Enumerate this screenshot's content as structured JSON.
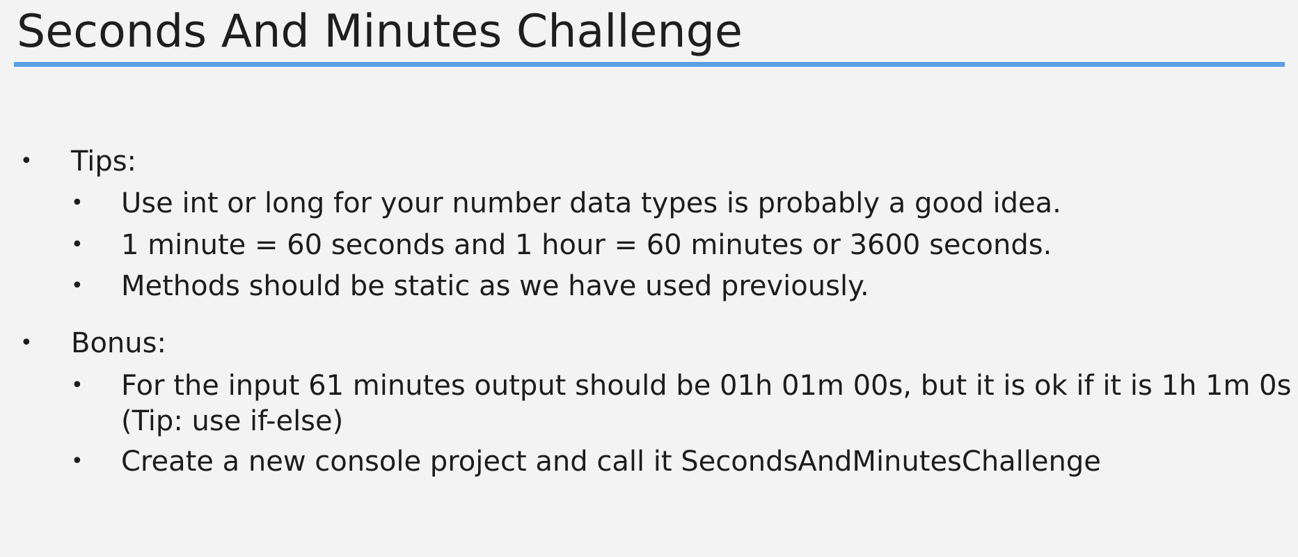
{
  "slide": {
    "title": "Seconds And Minutes Challenge"
  },
  "sections": [
    {
      "heading": "Tips:",
      "items": [
        "Use int or long for your number data types is probably a good idea.",
        "1 minute = 60 seconds and 1 hour = 60 minutes or 3600 seconds.",
        "Methods should be static as we have used previously."
      ]
    },
    {
      "heading": "Bonus:",
      "items": [
        {
          "line1": "For the input 61 minutes output should be 01h 01m 00s, but it is ok if it is 1h 1m 0s",
          "line2": "(Tip: use if-else)"
        },
        "Create a new console project and call it SecondsAndMinutesChallenge"
      ]
    }
  ],
  "bullet_char": "•",
  "colors": {
    "background": "#f3f3f3",
    "accent_rule": "#5b9fe6",
    "text": "#1c1c1c"
  }
}
